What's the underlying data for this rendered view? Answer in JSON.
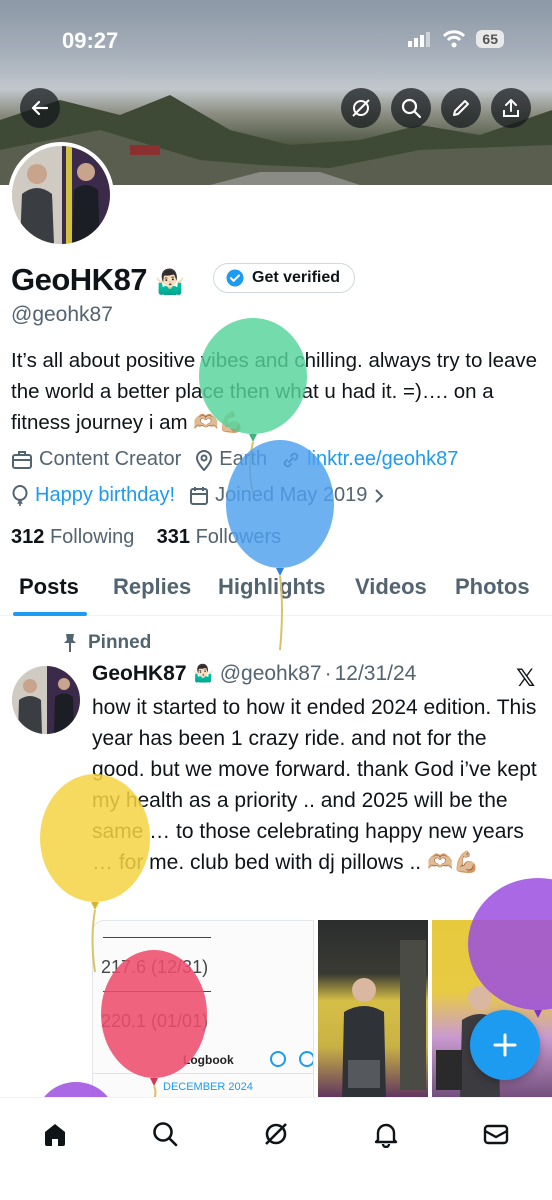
{
  "status_bar": {
    "time": "09:27",
    "battery": "65"
  },
  "profile": {
    "name": "GeoHK87",
    "name_emoji": "🤷🏻‍♂️",
    "get_verified_label": "Get verified",
    "handle": "@geohk87",
    "bio": "It’s all about positive vibes and chilling. always try to leave the world a better place then what u had it. =)…. on a fitness journey i am 🫶🏼💪🏼",
    "category": "Content Creator",
    "location": "Earth",
    "link": "linktr.ee/geohk87",
    "birthday": "Happy birthday!",
    "joined": "Joined May 2019",
    "following_count": "312",
    "following_label": "Following",
    "followers_count": "331",
    "followers_label": "Followers"
  },
  "tabs": [
    {
      "label": "Posts"
    },
    {
      "label": "Replies"
    },
    {
      "label": "Highlights"
    },
    {
      "label": "Videos"
    },
    {
      "label": "Photos"
    }
  ],
  "pinned_post": {
    "pinned_label": "Pinned",
    "author": "GeoHK87",
    "author_emoji": "🤷🏻‍♂️",
    "handle": "@geohk87",
    "separator": "·",
    "date": "12/31/24",
    "source_mark": "𝕏",
    "text": "how it started to how it ended 2024 edition. This year has been 1 crazy ride. and not for the good. but we move forward. thank God i’ve kept my health as a priority .. and 2025 will be the same … to those celebrating happy new years … for me. club bed with dj pillows .. 🫶🏼💪🏼",
    "media_card": {
      "entry1": "217.6 (12/31)",
      "entry2": "220.1 (01/01)",
      "app_title": "Logbook",
      "month": "DECEMBER 2024"
    }
  },
  "icons": {
    "back": "arrow-left-icon",
    "grok": "grok-icon",
    "search": "search-icon",
    "edit": "pencil-icon",
    "share": "share-icon",
    "home": "home-icon",
    "notifications": "bell-icon",
    "messages": "envelope-icon",
    "compose": "plus-icon"
  },
  "colors": {
    "accent": "#1d9bf0",
    "text": "#0f1419",
    "muted": "#536471"
  }
}
